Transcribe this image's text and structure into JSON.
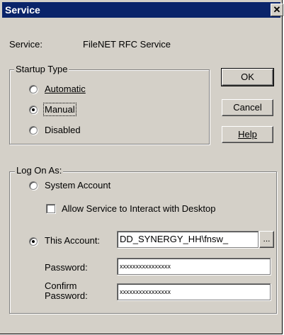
{
  "window": {
    "title": "Service",
    "close_glyph": "✕"
  },
  "service": {
    "label": "Service:",
    "name": "FileNET RFC Service"
  },
  "startup": {
    "group_label": "Startup Type",
    "options": [
      {
        "label": "Automatic",
        "selected": false
      },
      {
        "label": "Manual",
        "selected": true
      },
      {
        "label": "Disabled",
        "selected": false
      }
    ]
  },
  "buttons": {
    "ok": "OK",
    "cancel": "Cancel",
    "help": "Help"
  },
  "logon": {
    "group_label": "Log On As:",
    "system_account": {
      "label": "System Account",
      "selected": false
    },
    "interact_desktop": {
      "label": "Allow Service to Interact with Desktop",
      "checked": false
    },
    "this_account": {
      "label": "This Account:",
      "selected": true,
      "value": "DD_SYNERGY_HH\\fnsw_"
    },
    "browse_label": "...",
    "password": {
      "label": "Password:",
      "value": "xxxxxxxxxxxxxxxx"
    },
    "confirm": {
      "label_line1": "Confirm",
      "label_line2": "Password:",
      "value": "xxxxxxxxxxxxxxxx"
    }
  }
}
